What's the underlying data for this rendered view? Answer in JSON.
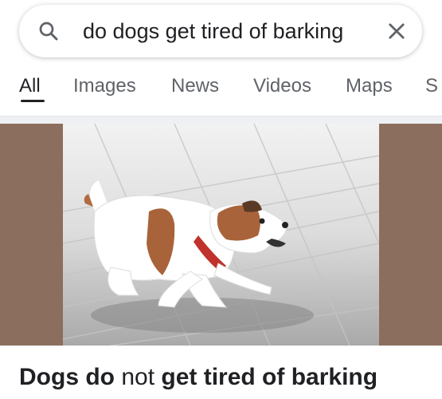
{
  "search": {
    "query": "do dogs get tired of barking",
    "icon": "search-icon",
    "clear_icon": "close-icon"
  },
  "tabs": [
    {
      "label": "All",
      "active": true
    },
    {
      "label": "Images",
      "active": false
    },
    {
      "label": "News",
      "active": false
    },
    {
      "label": "Videos",
      "active": false
    },
    {
      "label": "Maps",
      "active": false
    },
    {
      "label": "S",
      "active": false
    }
  ],
  "result": {
    "title_parts": [
      {
        "text": "Dogs do",
        "bold": true
      },
      {
        "text": " not ",
        "bold": false
      },
      {
        "text": "get tired of barking",
        "bold": true
      }
    ]
  },
  "colors": {
    "image_band": "#8c6e5e",
    "text_primary": "#202124",
    "text_secondary": "#5f6368"
  }
}
